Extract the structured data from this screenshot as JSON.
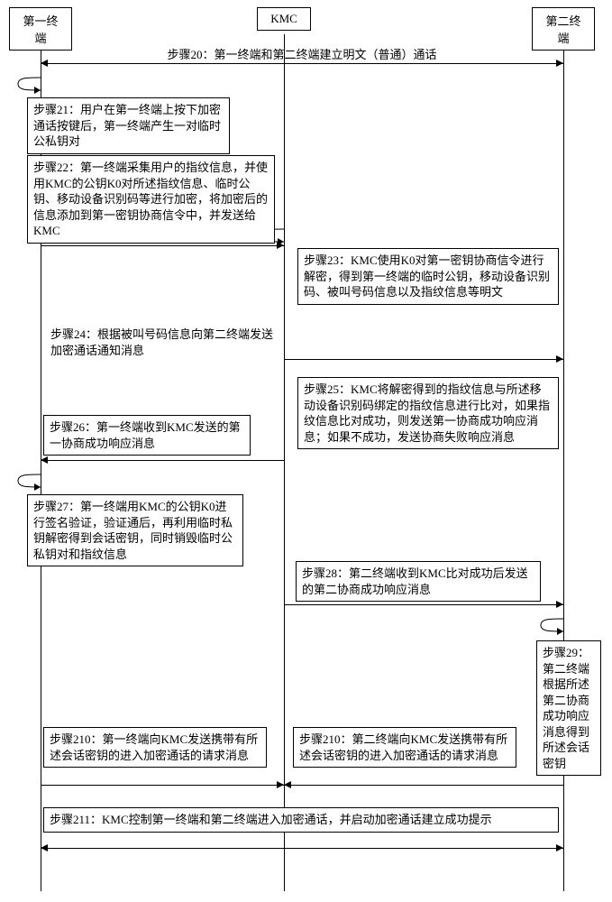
{
  "participants": {
    "terminal1": "第一终端",
    "kmc": "KMC",
    "terminal2": "第二终端"
  },
  "steps": {
    "s20": "步骤20：第一终端和第二终端建立明文（普通）通话",
    "s21": "步骤21：用户在第一终端上按下加密通话按键后，第一终端产生一对临时公私钥对",
    "s22": "步骤22：第一终端采集用户的指纹信息，并使用KMC的公钥K0对所述指纹信息、临时公钥、移动设备识别码等进行加密，将加密后的信息添加到第一密钥协商信令中，并发送给KMC",
    "s23": "步骤23：KMC使用K0对第一密钥协商信令进行解密，得到第一终端的临时公钥，移动设备识别码、被叫号码信息以及指纹信息等明文",
    "s24": "步骤24：根据被叫号码信息向第二终端发送加密通话通知消息",
    "s25": "步骤25：KMC将解密得到的指纹信息与所述移动设备识别码绑定的指纹信息进行比对，如果指纹信息比对成功，则发送第一协商成功响应消息；如果不成功，发送协商失败响应消息",
    "s26": "步骤26：第一终端收到KMC发送的第一协商成功响应消息",
    "s27": "步骤27：第一终端用KMC的公钥K0进行签名验证，验证通后，再利用临时私钥解密得到会话密钥，同时销毁临时公私钥对和指纹信息",
    "s28": "步骤28：第二终端收到KMC比对成功后发送的第二协商成功响应消息",
    "s29": "步骤29：第二终端根据所述第二协商成功响应消息得到所述会话密钥",
    "s210a": "步骤210：第一终端向KMC发送携带有所述会话密钥的进入加密通话的请求消息",
    "s210b": "步骤210：第二终端向KMC发送携带有所述会话密钥的进入加密通话的请求消息",
    "s211": "步骤211：KMC控制第一终端和第二终端进入加密通话，并启动加密通话建立成功提示"
  }
}
